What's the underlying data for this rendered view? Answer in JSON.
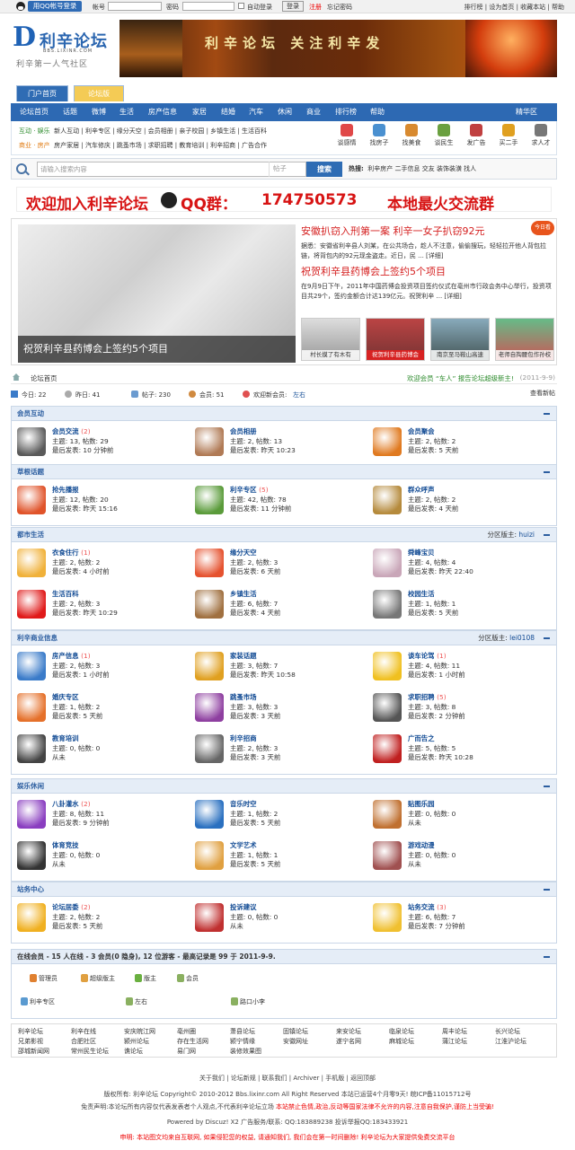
{
  "topbar": {
    "login_button": "用QQ帐号登录",
    "account_label": "帐号",
    "password_label": "密码",
    "auto_login": "自动登录",
    "login": "登录",
    "register": "注册",
    "forgot": "忘记密码",
    "links": "排行榜 | 设为首页 | 收藏本站 | 帮助"
  },
  "logo": {
    "mark": "D",
    "name": "利辛论坛",
    "url": "BBS.LIXINR.COM",
    "slogan": "利辛第一人气社区"
  },
  "banner": {
    "text": "利辛论坛 关注利辛发"
  },
  "tabs": [
    "门户首页",
    "论坛版"
  ],
  "nav": [
    "论坛首页",
    "话题",
    "微博",
    "生活",
    "房产信息",
    "家居",
    "结婚",
    "汽车",
    "休闲",
    "商业",
    "排行榜",
    "帮助"
  ],
  "nav_right": "精华区",
  "subnav": {
    "row1_head": "互动 · 娱乐",
    "row1": "新人互动 | 利辛专区 | 缘分天空 | 会员相册 | 亲子校园 | 乡镇生活 | 生活百科",
    "row2_head": "商业 · 房产",
    "row2": "房产家居 | 汽车修庆 | 跳蚤市场 | 求职招聘 | 教育培训 | 利辛招商 | 广告合作"
  },
  "quick_icons": [
    "谈感情",
    "找房子",
    "找美食",
    "谈民生",
    "发广告",
    "买二手",
    "求人才"
  ],
  "search": {
    "placeholder": "请输入搜索内容",
    "scope": "帖子",
    "button": "搜索",
    "hot_label": "热搜:",
    "hot": "利辛房产  二手信息  交友  装饰装潢  找人"
  },
  "qq_banner": {
    "a": "欢迎加入利辛论坛",
    "b": "QQ群：",
    "c": "174750573",
    "d": "本地最火交流群"
  },
  "slider": {
    "caption": "祝贺利辛县药博会上签约5个项目",
    "h1": "安徽扒窃入刑第一案  利辛一女子扒窃92元",
    "p1": "据悉：安徽省利辛县人刘某，在公共场合，趁人不注意，偷偷搜玩，轻轻拉开他人背包拉链，将背包内的92元现金盗走。近日，民 ... [详细]",
    "h2": "祝贺利辛县药博会上签约5个项目",
    "p2": "在9月9日下午，2011年中国药博会投资项目签约仪式在亳州市行政会务中心举行，投资项目共29个，签约金额合计达139亿元。祝贺利辛 ... [详细]",
    "badge": "今日看",
    "thumbs": [
      "村长摸了有木有",
      "祝贺利辛县药博会",
      "南京至马鞍山高速",
      "老师自掏腰包作孙校"
    ]
  },
  "crumb": {
    "home": "论坛首页",
    "notice": "欢迎会员 “车人” 报告论坛超级新主!",
    "date": "(2011-9-9)"
  },
  "stats": {
    "today": "今日: 22",
    "yesterday": "昨日: 41",
    "posts": "帖子: 230",
    "members": "会员: 51",
    "newest": "欢迎新会员:",
    "newest_name": "左右",
    "view_new": "查看新帖"
  },
  "sections": [
    {
      "title": "会员互动",
      "mod": "",
      "forums": [
        {
          "name": "会员交流",
          "today": "(2)",
          "stat": "主题: 13, 帖数: 29",
          "last": "最后发表: 10 分钟前",
          "color": "#5a5a5a"
        },
        {
          "name": "会员相册",
          "today": "",
          "stat": "主题: 2, 帖数: 13",
          "last": "最后发表: 昨天 10:23",
          "color": "#b07a55"
        },
        {
          "name": "会员聚会",
          "today": "",
          "stat": "主题: 2, 帖数: 2",
          "last": "最后发表: 5 天前",
          "color": "#e07a20"
        }
      ]
    },
    {
      "title": "草根话题",
      "mod": "",
      "forums": [
        {
          "name": "抢先播报",
          "today": "",
          "stat": "主题: 12, 帖数: 20",
          "last": "最后发表: 昨天 15:16",
          "color": "#e0532a"
        },
        {
          "name": "利辛专区",
          "today": "(5)",
          "stat": "主题: 42, 帖数: 78",
          "last": "最后发表: 11 分钟前",
          "color": "#5a9b3a"
        },
        {
          "name": "群众呼声",
          "today": "",
          "stat": "主题: 2, 帖数: 2",
          "last": "最后发表: 4 天前",
          "color": "#b58a3c"
        }
      ]
    },
    {
      "title": "都市生活",
      "mod": "分区版主:",
      "mod_name": "huizi",
      "forums": [
        {
          "name": "衣食住行",
          "today": "(1)",
          "stat": "主题: 2, 帖数: 2",
          "last": "最后发表: 4 小时前",
          "color": "#f0b13a"
        },
        {
          "name": "缘分天空",
          "today": "",
          "stat": "主题: 2, 帖数: 3",
          "last": "最后发表: 6 天前",
          "color": "#e5522f"
        },
        {
          "name": "舜峰宝贝",
          "today": "",
          "stat": "主题: 4, 帖数: 4",
          "last": "最后发表: 昨天 22:40",
          "color": "#c9a6b8"
        },
        {
          "name": "生活百科",
          "today": "",
          "stat": "主题: 2, 帖数: 3",
          "last": "最后发表: 昨天 10:29",
          "color": "#e01a1a"
        },
        {
          "name": "乡镇生活",
          "today": "",
          "stat": "主题: 6, 帖数: 7",
          "last": "最后发表: 4 天前",
          "color": "#a07040"
        },
        {
          "name": "校园生活",
          "today": "",
          "stat": "主题: 1, 帖数: 1",
          "last": "最后发表: 5 天前",
          "color": "#777"
        }
      ]
    },
    {
      "title": "利辛商业信息",
      "mod": "分区版主:",
      "mod_name": "lei0108",
      "forums": [
        {
          "name": "房产信息",
          "today": "(1)",
          "stat": "主题: 2, 帖数: 3",
          "last": "最后发表: 1 小时前",
          "color": "#3a7bc9"
        },
        {
          "name": "家装话题",
          "today": "",
          "stat": "主题: 3, 帖数: 7",
          "last": "最后发表: 昨天 10:58",
          "color": "#e0a020"
        },
        {
          "name": "谈车论驾",
          "today": "(1)",
          "stat": "主题: 4, 帖数: 11",
          "last": "最后发表: 1 小时前",
          "color": "#f0c020"
        },
        {
          "name": "婚庆专区",
          "today": "",
          "stat": "主题: 1, 帖数: 2",
          "last": "最后发表: 5 天前",
          "color": "#e5702a"
        },
        {
          "name": "跳蚤市场",
          "today": "",
          "stat": "主题: 3, 帖数: 3",
          "last": "最后发表: 3 天前",
          "color": "#8e3fa0"
        },
        {
          "name": "求职招聘",
          "today": "(5)",
          "stat": "主题: 3, 帖数: 8",
          "last": "最后发表: 2 分钟前",
          "color": "#555"
        },
        {
          "name": "教育培训",
          "today": "",
          "stat": "主题: 0, 帖数: 0",
          "last": "从未",
          "color": "#444"
        },
        {
          "name": "利辛招商",
          "today": "",
          "stat": "主题: 2, 帖数: 3",
          "last": "最后发表: 3 天前",
          "color": "#666"
        },
        {
          "name": "广而告之",
          "today": "",
          "stat": "主题: 5, 帖数: 5",
          "last": "最后发表: 昨天 10:28",
          "color": "#c02020"
        }
      ]
    },
    {
      "title": "娱乐休闲",
      "mod": "",
      "forums": [
        {
          "name": "八卦灌水",
          "today": "(2)",
          "stat": "主题: 8, 帖数: 11",
          "last": "最后发表: 9 分钟前",
          "color": "#8a3ec0"
        },
        {
          "name": "音乐时空",
          "today": "",
          "stat": "主题: 1, 帖数: 2",
          "last": "最后发表: 5 天前",
          "color": "#2a70c0"
        },
        {
          "name": "贴图乐园",
          "today": "",
          "stat": "主题: 0, 帖数: 0",
          "last": "从未",
          "color": "#c07030"
        },
        {
          "name": "体育竞技",
          "today": "",
          "stat": "主题: 0, 帖数: 0",
          "last": "从未",
          "color": "#333"
        },
        {
          "name": "文学艺术",
          "today": "",
          "stat": "主题: 1, 帖数: 1",
          "last": "最后发表: 5 天前",
          "color": "#e0a040"
        },
        {
          "name": "游戏动漫",
          "today": "",
          "stat": "主题: 0, 帖数: 0",
          "last": "从未",
          "color": "#a05050"
        }
      ]
    },
    {
      "title": "站务中心",
      "mod": "",
      "forums": [
        {
          "name": "论坛居委",
          "today": "(2)",
          "stat": "主题: 2, 帖数: 2",
          "last": "最后发表: 5 天前",
          "color": "#f0b020"
        },
        {
          "name": "投诉建议",
          "today": "",
          "stat": "主题: 0, 帖数: 0",
          "last": "从未",
          "color": "#c03030"
        },
        {
          "name": "站务交流",
          "today": "(3)",
          "stat": "主题: 6, 帖数: 7",
          "last": "最后发表: 7 分钟前",
          "color": "#f0c030"
        }
      ]
    }
  ],
  "online": {
    "title": "在线会员 - 15 人在线 - 3 会员(0 隐身), 12 位游客 - 最高记录是 99 于 2011-9-9.",
    "legend": [
      "管理员",
      "超级版主",
      "版主",
      "会员"
    ],
    "users": [
      "利辛专区",
      "左右",
      "路口小李"
    ]
  },
  "links": [
    [
      "利辛论坛",
      "利辛在线",
      "安庆皖江网",
      "亳州圈",
      "萧县论坛",
      "固镇论坛",
      "来安论坛",
      "临泉论坛",
      "周丰论坛",
      "长兴论坛"
    ],
    [
      "兄弟影视",
      "合肥社区",
      "颍州论坛",
      "存在生活网",
      "颍宁情缘",
      "安徽网址",
      "遂宁名网",
      "麻城论坛",
      "蒲江论坛",
      "江淮沪论坛"
    ],
    [
      "邵城新闻网",
      "常州民生论坛",
      "谯论坛",
      "易门网",
      "装修效果图"
    ]
  ],
  "footer": {
    "l1": "关于我们 | 论坛新规 | 联系我们 | Archiver | 手机版 | 返回顶部",
    "l2": "版权所有: 利辛论坛 Copyright© 2010-2012 Bbs.lixinr.com All Right Reserved 本站已运营4个月零9天! 皖ICP备11015712号",
    "l3a": "免责声明:本论坛所有内容仅代表发表者个人观点,不代表利辛论坛立场 ",
    "l3b": "本站禁止色情,政治,反动等国家法律不允许的内容,注意自我保护,谨防上当受骗!",
    "l4": "Powered by Discuz! X2 广告服务/联系: QQ:183889238  投诉举报QQ:183433921",
    "l5": "申明: 本站图文均来自互联网, 如果侵犯您的权益, 请通知我们, 我们会在第一时间删除! 利辛论坛为大家提供免费交流平台"
  }
}
